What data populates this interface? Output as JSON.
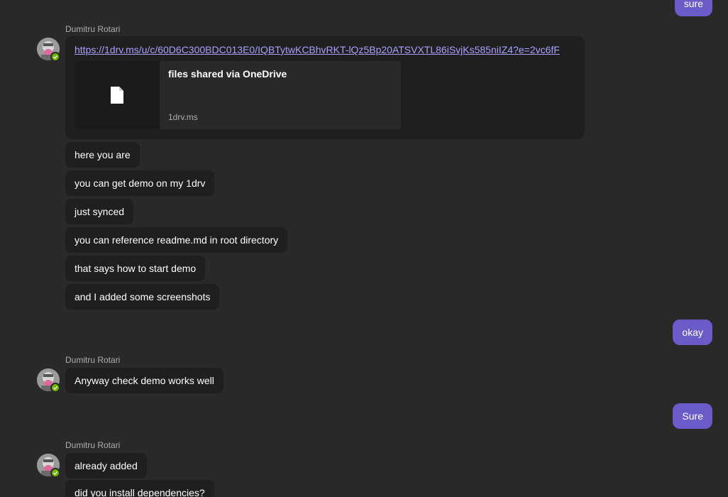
{
  "sender": "Dumitru Rotari",
  "link_card": {
    "url": "https://1drv.ms/u/c/60D6C300BDC013E0/IQBTytwKCBhvRKT-lQz5Bp20ATSVXTL86iSvjKs585niIZ4?e=2vc6fF",
    "preview_title": "files shared via OneDrive",
    "preview_domain": "1drv.ms",
    "preview_icon": "document-icon"
  },
  "group1": {
    "messages": [
      "here you are",
      "you can get demo on my 1drv",
      "just synced",
      "you can reference readme.md in root directory",
      "that says how to start demo",
      "and I added some screenshots"
    ]
  },
  "group2": {
    "messages": [
      "Anyway check demo works well"
    ]
  },
  "group3": {
    "messages": [
      "already added",
      "did you install dependencies?"
    ]
  },
  "mine": {
    "top": "sure",
    "okay": "okay",
    "sure": "Sure"
  },
  "colors": {
    "background": "#292929",
    "incoming_bubble": "#1f1f1f",
    "outgoing_bubble": "#6b5bc9",
    "link": "#a9a0ff",
    "presence_available": "#6bb700"
  }
}
